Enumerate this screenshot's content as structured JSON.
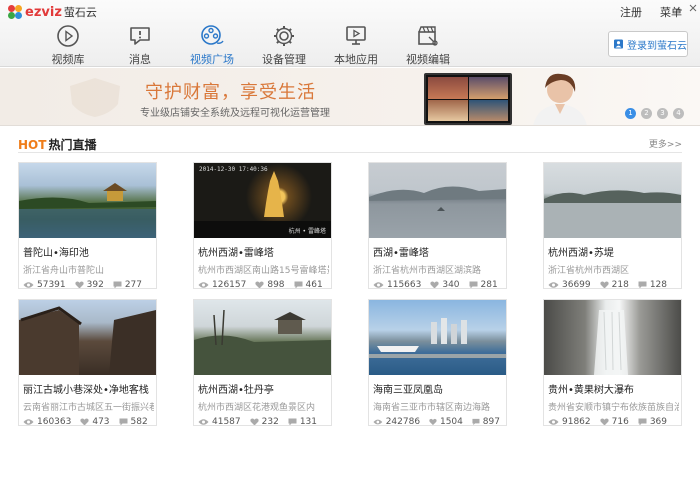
{
  "app": {
    "logo_text": "ezviz",
    "logo_cn": "萤石云"
  },
  "top_links": {
    "register": "注册",
    "menu": "菜单"
  },
  "nav": [
    {
      "label": "视频库",
      "icon": "play-icon",
      "active": false
    },
    {
      "label": "消息",
      "icon": "message-icon",
      "active": false
    },
    {
      "label": "视频广场",
      "icon": "film-reel-icon",
      "active": true
    },
    {
      "label": "设备管理",
      "icon": "gear-icon",
      "active": false
    },
    {
      "label": "本地应用",
      "icon": "monitor-play-icon",
      "active": false
    },
    {
      "label": "视频编辑",
      "icon": "clapper-scissors-icon",
      "active": false
    }
  ],
  "login": {
    "label": "登录到萤石云",
    "icon": "user-icon"
  },
  "banner": {
    "title": "守护财富，享受生活",
    "subtitle": "专业级店铺安全系统及远程可视化运营管理",
    "pages": [
      "1",
      "2",
      "3",
      "4"
    ],
    "active_page": 0
  },
  "section": {
    "hot": "HOT",
    "title": "热门直播",
    "more": "更多>>"
  },
  "cards": [
    {
      "title": "普陀山•海印池",
      "address": "浙江省舟山市普陀山",
      "views": "57391",
      "likes": "392",
      "comments": "277",
      "timestamp": "",
      "watermark": ""
    },
    {
      "title": "杭州西湖•雷峰塔",
      "address": "杭州市西湖区南山路15号雷峰塔景...",
      "views": "126157",
      "likes": "898",
      "comments": "461",
      "timestamp": "2014-12-30 17:40:36",
      "watermark": "杭州 • 雷峰塔"
    },
    {
      "title": "西湖•雷峰塔",
      "address": "浙江省杭州市西湖区湖滨路",
      "views": "115663",
      "likes": "340",
      "comments": "281",
      "timestamp": "",
      "watermark": ""
    },
    {
      "title": "杭州西湖•苏堤",
      "address": "浙江省杭州市西湖区",
      "views": "36699",
      "likes": "218",
      "comments": "128",
      "timestamp": "",
      "watermark": ""
    },
    {
      "title": "丽江古城小巷深处•净地客栈",
      "address": "云南省丽江市古城区五一街振兴巷...",
      "views": "160363",
      "likes": "473",
      "comments": "582",
      "timestamp": "",
      "watermark": ""
    },
    {
      "title": "杭州西湖•牡丹亭",
      "address": "杭州市西湖区花港观鱼景区内",
      "views": "41587",
      "likes": "232",
      "comments": "131",
      "timestamp": "",
      "watermark": ""
    },
    {
      "title": "海南三亚凤凰岛",
      "address": "海南省三亚市市辖区南边海路",
      "views": "242786",
      "likes": "1504",
      "comments": "897",
      "timestamp": "",
      "watermark": ""
    },
    {
      "title": "贵州•黄果树大瀑布",
      "address": "贵州省安顺市镇宁布依族苗族自治...",
      "views": "91862",
      "likes": "716",
      "comments": "369",
      "timestamp": "",
      "watermark": ""
    }
  ],
  "colors": {
    "accent": "#2b78c9",
    "hot": "#ef7d1a",
    "banner_title": "#d9783a",
    "dot_active": "#3a8ee6"
  }
}
